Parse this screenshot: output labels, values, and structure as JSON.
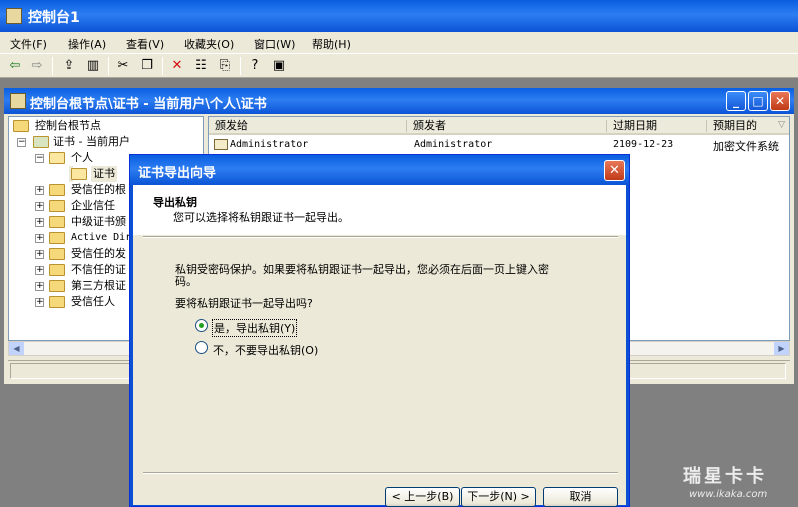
{
  "window": {
    "title": "控制台1"
  },
  "menu": [
    "文件(F)",
    "操作(A)",
    "查看(V)",
    "收藏夹(O)",
    "窗口(W)",
    "帮助(H)"
  ],
  "toolbar_icons": [
    "back-icon",
    "forward-icon",
    "up-folder-icon",
    "show-tree-icon",
    "cut-icon",
    "copy-icon",
    "delete-icon",
    "properties-icon",
    "export-list-icon",
    "help-icon",
    "show-hide-icon"
  ],
  "mdi": {
    "title": "控制台根节点\\证书 - 当前用户\\个人\\证书"
  },
  "tree": [
    {
      "label": "控制台根节点"
    },
    {
      "label": "证书 - 当前用户"
    },
    {
      "label": "个人"
    },
    {
      "label": "证书"
    },
    {
      "label": "受信任的根"
    },
    {
      "label": "企业信任"
    },
    {
      "label": "中级证书颁"
    },
    {
      "label": "Active Dir"
    },
    {
      "label": "受信任的发"
    },
    {
      "label": "不信任的证"
    },
    {
      "label": "第三方根证"
    },
    {
      "label": "受信任人"
    }
  ],
  "list": {
    "columns": [
      "颁发给",
      "颁发者",
      "过期日期",
      "预期目的"
    ],
    "rows": [
      {
        "issued_to": "Administrator",
        "issued_by": "Administrator",
        "expires": "2109-12-23",
        "purpose": "加密文件系统"
      }
    ]
  },
  "dialog": {
    "title": "证书导出向导",
    "heading": "导出私钥",
    "subheading": "您可以选择将私钥跟证书一起导出。",
    "info_line1": "私钥受密码保护。如果要将私钥跟证书一起导出，您必须在后面一页上键入密",
    "info_line2": "码。",
    "question": "要将私钥跟证书一起导出吗?",
    "option_yes": "是，导出私钥(Y)",
    "option_no": "不，不要导出私钥(O)",
    "selected": "yes",
    "btn_back": "< 上一步(B)",
    "btn_next": "下一步(N) >",
    "btn_cancel": "取消"
  },
  "watermark": {
    "brand": "瑞星卡卡",
    "url": "www.ikaka.com"
  }
}
